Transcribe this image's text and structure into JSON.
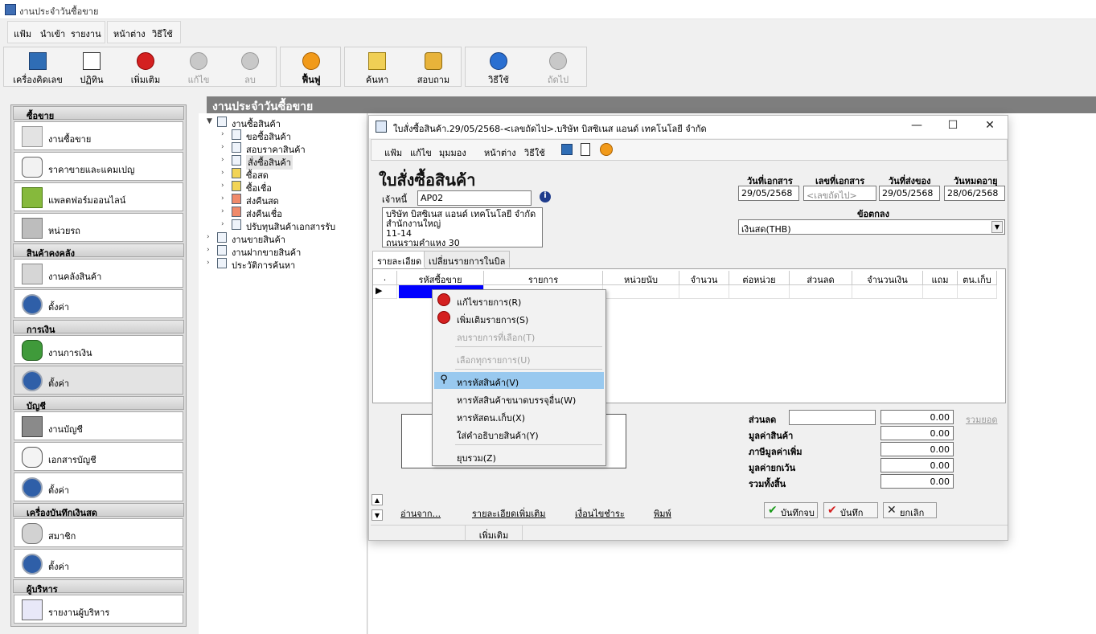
{
  "app": {
    "title": "งานประจำวันซื้อขาย"
  },
  "main_menu": {
    "file": "แฟ้ม",
    "import": "นำเข้า",
    "report": "รายงาน",
    "window": "หน้าต่าง",
    "help": "วิธีใช้"
  },
  "toolbar": {
    "calculator": "เครื่องคิดเลข",
    "calendar": "ปฏิทิน",
    "add": "เพิ่มเติม",
    "edit": "แก้ไข",
    "delete": "ลบ",
    "restore": "ฟื้นฟู",
    "search": "ค้นหา",
    "inquiry": "สอบถาม",
    "help": "วิธีใช้",
    "next": "ถัดไป"
  },
  "sidebar": {
    "sections": [
      {
        "title": "ซื้อขาย",
        "items": [
          "งานซื้อขาย",
          "ราคาขายและแคมเปญ",
          "แพลตฟอร์มออนไลน์",
          "หน่วยรถ"
        ]
      },
      {
        "title": "สินค้าคงคลัง",
        "items": [
          "งานคลังสินค้า",
          "ตั้งค่า"
        ]
      },
      {
        "title": "การเงิน",
        "items": [
          "งานการเงิน",
          "ตั้งค่า"
        ]
      },
      {
        "title": "บัญชี",
        "items": [
          "งานบัญชี",
          "เอกสารบัญชี",
          "ตั้งค่า"
        ]
      },
      {
        "title": "เครื่องบันทึกเงินสด",
        "items": [
          "สมาชิก",
          "ตั้งค่า"
        ]
      },
      {
        "title": "ผู้บริหาร",
        "items": [
          "รายงานผู้บริหาร"
        ]
      }
    ]
  },
  "main_header": "งานประจำวันซื้อขาย",
  "tree": {
    "root1": "งานซื้อสินค้า",
    "children": [
      "ขอซื้อสินค้า",
      "สอบราคาสินค้า",
      "สั่งซื้อสินค้า",
      "ซื้อสด",
      "ซื้อเชื่อ",
      "ส่งคืนสด",
      "ส่งคืนเชื่อ",
      "ปรับทุนสินค้าเอกสารรับ"
    ],
    "root2": "งานขายสินค้า",
    "root3": "งานฝากขายสินค้า",
    "root4": "ประวัติการค้นหา"
  },
  "dialog": {
    "window_title": "ใบสั่งซื้อสินค้า.29/05/2568-<เลขถัดไป>.บริษัท บิสซิเนส แอนด์ เทคโนโลยี จำกัด",
    "menu": {
      "file": "แฟ้ม",
      "edit": "แก้ไข",
      "view": "มุมมอง",
      "window": "หน้าต่าง",
      "help": "วิธีใช้"
    },
    "doc_title": "ใบสั่งซื้อสินค้า",
    "creditor_label": "เจ้าหนี้",
    "creditor_value": "AP02",
    "address_lines": [
      "บริษัท บิสซิเนส แอนด์ เทคโนโลยี จำกัด",
      "สำนักงานใหญ่",
      "11-14",
      "ถนนรามคำแหง 30"
    ],
    "doc_date_label": "วันที่เอกสาร",
    "doc_date": "29/05/2568",
    "doc_no_label": "เลขที่เอกสาร",
    "doc_no_placeholder": "<เลขถัดไป>",
    "delivery_date_label": "วันที่ส่งของ",
    "delivery_date": "29/05/2568",
    "expire_label": "วันหมดอายุ",
    "expire_date": "28/06/2568",
    "terms_label": "ข้อตกลง",
    "terms_value": "เงินสด(THB)",
    "tabs": [
      "รายละเอียด",
      "เปลี่ยนรายการในบิล"
    ],
    "grid_headers": [
      ".",
      "รหัสซื้อขาย",
      "รายการ",
      "หน่วยนับ",
      "จำนวน",
      "ต่อหน่วย",
      "ส่วนลด",
      "จำนวนเงิน",
      "แถม",
      "ตน.เก็บ"
    ],
    "summary": {
      "discount_label": "ส่วนลด",
      "discount_value": "0.00",
      "total_link": "รวมยอด",
      "goods_label": "มูลค่าสินค้า",
      "goods_value": "0.00",
      "vat_label": "ภาษีมูลค่าเพิ่ม",
      "vat_value": "0.00",
      "exempt_label": "มูลค่ายกเว้น",
      "exempt_value": "0.00",
      "grand_label": "รวมทั้งสิ้น",
      "grand_value": "0.00"
    },
    "links": {
      "read_from": "อ่านจาก...",
      "more_details": "รายละเอียดเพิ่มเติม",
      "payment_terms": "เงื่อนไขชำระ",
      "print": "พิมพ์"
    },
    "buttons": {
      "save_close": "บันทึกจบ",
      "save": "บันทึก",
      "cancel": "ยกเลิก"
    },
    "status": "เพิ่มเติม"
  },
  "context_menu": {
    "items": [
      "แก้ไขรายการ(R)",
      "เพิ่มเติมรายการ(S)",
      "ลบรายการที่เลือก(T)",
      "เลือกทุกรายการ(U)",
      "หารหัสสินค้า(V)",
      "หารหัสสินค้าขนาดบรรจุอื่น(W)",
      "หารหัสตน.เก็บ(X)",
      "ใส่คำอธิบายสินค้า(Y)",
      "ยุบรวม(Z)"
    ]
  },
  "colors": {
    "accent_red": "#d42020",
    "header_gray": "#7e7e7e",
    "highlight": "#99c9ef",
    "selected_cell": "#0000ff"
  }
}
